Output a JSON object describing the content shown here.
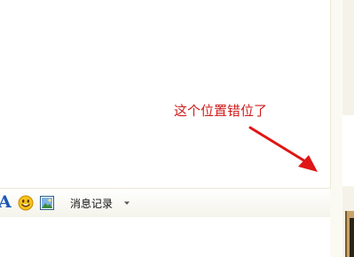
{
  "toolbar": {
    "font_glyph": "A",
    "history_label": "消息记录"
  },
  "icons": {
    "font": "font-icon",
    "emoji": "smiley-icon",
    "image": "image-icon",
    "dropdown": "dropdown-arrow-icon"
  },
  "annotation": {
    "text": "这个位置错位了",
    "color": "#d11a1a"
  },
  "colors": {
    "font_icon": "#1b58b8",
    "smiley": "#f5c21b",
    "page_bg": "#fbfaf2"
  }
}
